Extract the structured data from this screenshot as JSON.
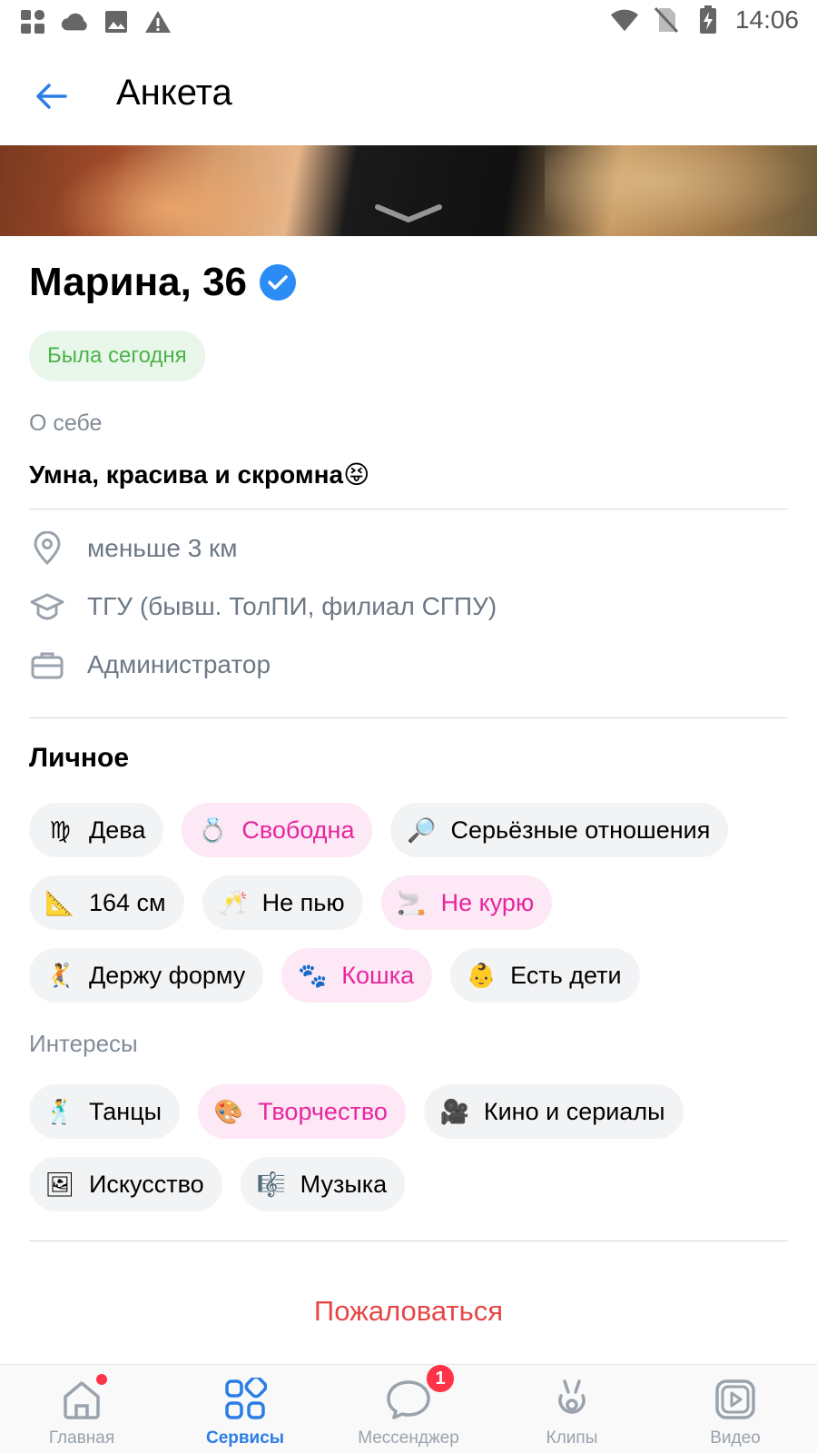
{
  "status_bar": {
    "time": "14:06"
  },
  "header": {
    "title": "Анкета"
  },
  "profile": {
    "name": "Марина, 36",
    "online_status": "Была сегодня",
    "about_label": "О себе",
    "about_text": "Умна, красива и скромна",
    "about_emoji": "😝"
  },
  "info": {
    "distance": "меньше 3 км",
    "education": "ТГУ (бывш. ТолПИ, филиал СГПУ)",
    "job": "Администратор"
  },
  "personal": {
    "title": "Личное",
    "chips": [
      {
        "emoji": "♍",
        "label": "Дева",
        "highlight": false
      },
      {
        "emoji": "💍",
        "label": "Свободна",
        "highlight": true
      },
      {
        "emoji": "🔎",
        "label": "Серьёзные отношения",
        "highlight": false
      },
      {
        "emoji": "📐",
        "label": "164 см",
        "highlight": false
      },
      {
        "emoji": "🥂",
        "label": "Не пью",
        "highlight": false
      },
      {
        "emoji": "🚬",
        "label": "Не курю",
        "highlight": true
      },
      {
        "emoji": "🤾",
        "label": "Держу форму",
        "highlight": false
      },
      {
        "emoji": "🐾",
        "label": "Кошка",
        "highlight": true
      },
      {
        "emoji": "👶",
        "label": "Есть дети",
        "highlight": false
      }
    ]
  },
  "interests": {
    "title": "Интересы",
    "chips": [
      {
        "emoji": "🕺",
        "label": "Танцы",
        "highlight": false
      },
      {
        "emoji": "🎨",
        "label": "Творчество",
        "highlight": true
      },
      {
        "emoji": "🎥",
        "label": "Кино и сериалы",
        "highlight": false
      },
      {
        "emoji": "🖼",
        "label": "Искусство",
        "highlight": false
      },
      {
        "emoji": "🎼",
        "label": "Музыка",
        "highlight": false
      }
    ]
  },
  "report_label": "Пожаловаться",
  "tabbar": {
    "tabs": [
      {
        "label": "Главная",
        "icon": "home-icon"
      },
      {
        "label": "Сервисы",
        "icon": "services-icon"
      },
      {
        "label": "Мессенджер",
        "icon": "messenger-icon",
        "badge": "1"
      },
      {
        "label": "Клипы",
        "icon": "clips-icon"
      },
      {
        "label": "Видео",
        "icon": "video-icon"
      }
    ]
  },
  "colors": {
    "accent": "#2b7de6",
    "online_green": "#4bb34b",
    "pink_chip_text": "#e6269f",
    "report_red": "#e64646"
  }
}
